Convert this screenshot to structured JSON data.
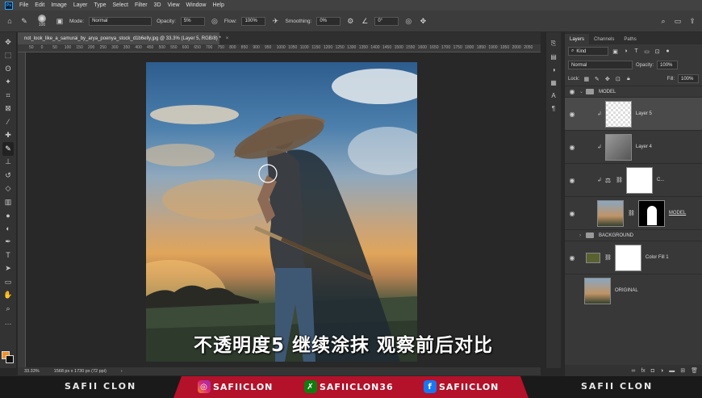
{
  "menu": [
    "File",
    "Edit",
    "Image",
    "Layer",
    "Type",
    "Select",
    "Filter",
    "3D",
    "View",
    "Window",
    "Help"
  ],
  "options": {
    "brush_size": "100",
    "mode_label": "Mode:",
    "mode_value": "Normal",
    "opacity_label": "Opacity:",
    "opacity_value": "5%",
    "flow_label": "Flow:",
    "flow_value": "100%",
    "smoothing_label": "Smoothing:",
    "smoothing_value": "0%",
    "angle_value": "0°"
  },
  "document": {
    "tab_title": "not_look_like_a_samurai_by_arya_poenya_stock_d1b6elly.jpg @ 33.3% (Layer 5, RGB/8) *",
    "zoom": "33.33%",
    "dimensions": "1568 px x 1730 px (72 ppi)"
  },
  "ruler_ticks": [
    "50",
    "0",
    "50",
    "100",
    "150",
    "200",
    "250",
    "300",
    "350",
    "400",
    "450",
    "500",
    "550",
    "600",
    "650",
    "700",
    "750",
    "800",
    "850",
    "900",
    "950",
    "1000",
    "1050",
    "1100",
    "1150",
    "1200",
    "1250",
    "1300",
    "1350",
    "1400",
    "1450",
    "1500",
    "1550",
    "1600",
    "1650",
    "1700",
    "1750",
    "1800",
    "1850",
    "1900",
    "1950",
    "2000",
    "2050",
    "2100"
  ],
  "layers_panel": {
    "tabs": [
      "Layers",
      "Channels",
      "Paths"
    ],
    "filter_label": "Kind",
    "blend_mode": "Normal",
    "opacity_label": "Opacity:",
    "opacity_value": "100%",
    "lock_label": "Lock:",
    "fill_label": "Fill:",
    "fill_value": "100%",
    "layers": [
      {
        "name": "MODEL",
        "kind": "group"
      },
      {
        "name": "Layer 5",
        "kind": "pixel"
      },
      {
        "name": "Layer 4",
        "kind": "pixel"
      },
      {
        "name": "C...",
        "kind": "adjustment"
      },
      {
        "name": "MODEL",
        "kind": "masked"
      },
      {
        "name": "BACKGROUND",
        "kind": "group"
      },
      {
        "name": "Color Fill 1",
        "kind": "fill"
      },
      {
        "name": "ORIGINAL",
        "kind": "image"
      }
    ]
  },
  "subtitle": "不透明度5 继续涂抹 观察前后对比",
  "banner": {
    "left_name": "SAFII CLON",
    "right_name": "SAFII CLON",
    "instagram": "SAFIICLON",
    "xbox": "SAFIICLON36",
    "facebook": "SAFIICLON",
    "colors": {
      "red": "#b3122a",
      "instagram": "#d62976",
      "xbox": "#107c10",
      "facebook": "#1877f2"
    }
  },
  "colors": {
    "foreground": "#f39226",
    "background": "#111111"
  }
}
